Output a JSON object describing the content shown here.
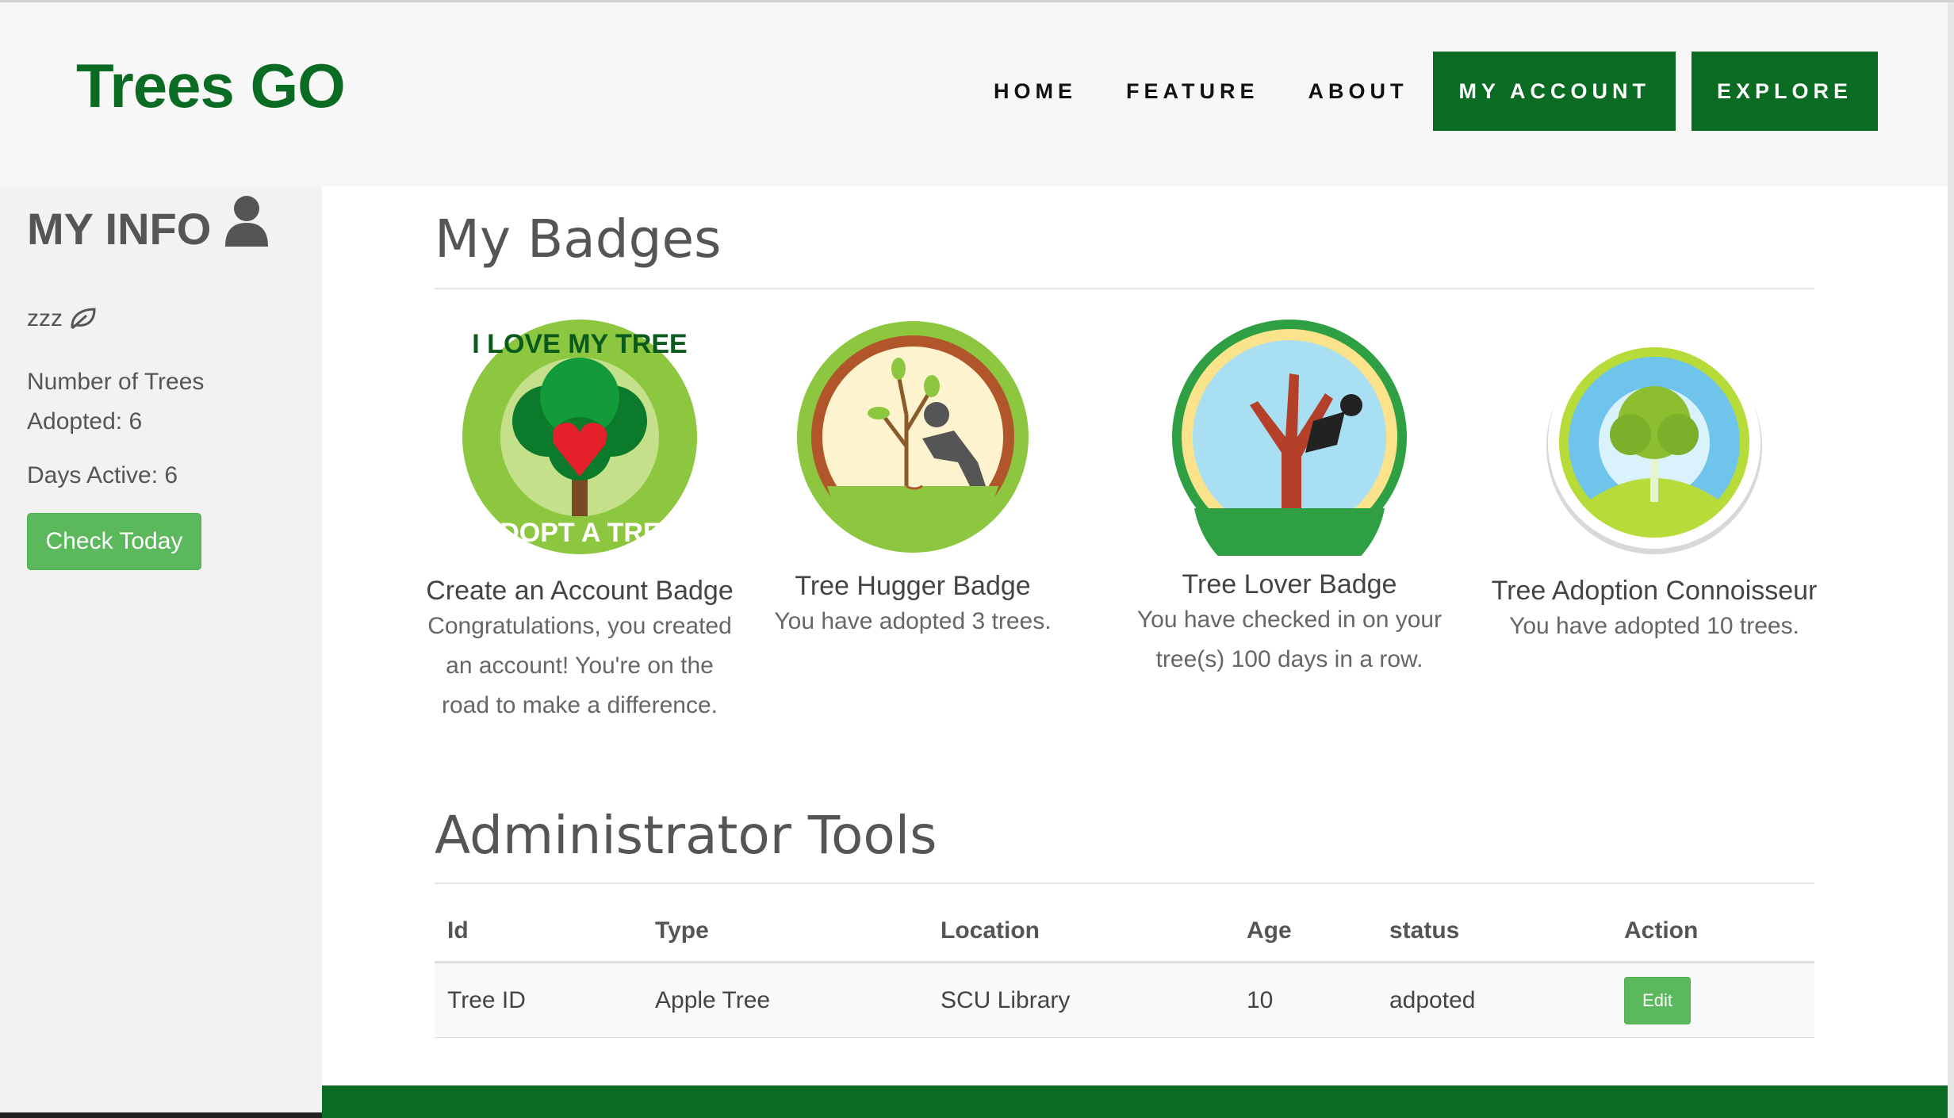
{
  "brand": "Trees GO",
  "nav": {
    "home": "HOME",
    "feature": "FEATURE",
    "about": "ABOUT",
    "my_account": "MY ACCOUNT",
    "explore": "EXPLORE"
  },
  "sidebar": {
    "title": "MY INFO",
    "username": "zzz",
    "trees_adopted": "Number of Trees Adopted: 6",
    "days_active": "Days Active: 6",
    "check_button": "Check Today"
  },
  "badges_section": {
    "title": "My Badges",
    "badges": [
      {
        "title": "Create an Account Badge",
        "desc": "Congratulations, you created an account! You're on the road to make a difference.",
        "logo_text_top": "I LOVE MY TREE",
        "logo_text_bottom": "ADOPT A TREE"
      },
      {
        "title": "Tree Hugger Badge",
        "desc": "You have adopted 3 trees."
      },
      {
        "title": "Tree Lover Badge",
        "desc": "You have checked in on your tree(s) 100 days in a row."
      },
      {
        "title": "Tree Adoption Connoisseur",
        "desc": "You have adopted 10 trees."
      }
    ]
  },
  "admin_section": {
    "title": "Administrator Tools",
    "columns": [
      "Id",
      "Type",
      "Location",
      "Age",
      "status",
      "Action"
    ],
    "rows": [
      {
        "id": "Tree ID",
        "type": "Apple Tree",
        "location": "SCU Library",
        "age": "10",
        "status": "adpoted",
        "action": "Edit"
      }
    ]
  },
  "colors": {
    "brand_green": "#0a6b22",
    "button_green": "#5cb85c"
  }
}
